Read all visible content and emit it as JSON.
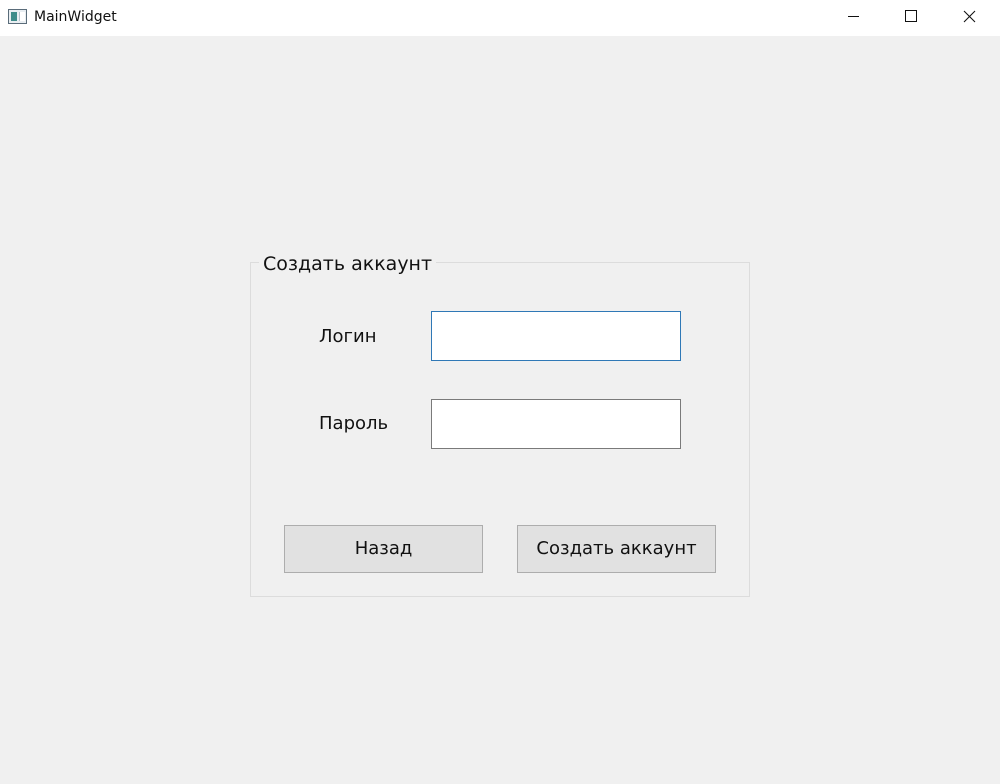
{
  "window": {
    "title": "MainWidget",
    "icon": "app-window-icon",
    "controls": {
      "minimize_icon": "minimize-icon",
      "maximize_icon": "maximize-icon",
      "close_icon": "close-icon"
    }
  },
  "form": {
    "group_title": "Создать аккаунт",
    "login_label": "Логин",
    "login_value": "",
    "password_label": "Пароль",
    "password_value": "",
    "back_button_label": "Назад",
    "create_button_label": "Создать аккаунт"
  },
  "colors": {
    "background": "#f0f0f0",
    "titlebar": "#ffffff",
    "focus_border": "#2f78b6",
    "button_face": "#e1e1e1"
  }
}
